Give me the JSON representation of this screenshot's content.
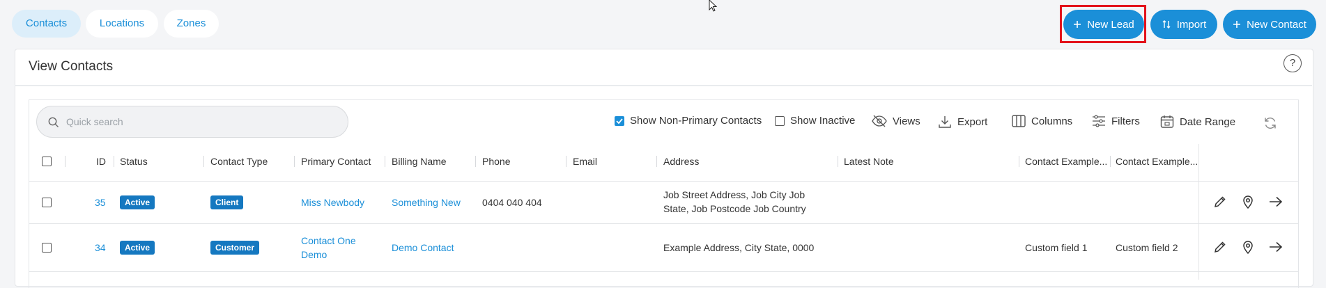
{
  "tabs": [
    {
      "label": "Contacts",
      "active": true
    },
    {
      "label": "Locations",
      "active": false
    },
    {
      "label": "Zones",
      "active": false
    }
  ],
  "actions": {
    "new_lead": "New Lead",
    "import": "Import",
    "new_contact": "New Contact"
  },
  "card": {
    "title": "View Contacts",
    "help": "?"
  },
  "toolbar": {
    "search_placeholder": "Quick search",
    "show_non_primary": "Show Non-Primary Contacts",
    "show_non_primary_checked": true,
    "show_inactive": "Show Inactive",
    "show_inactive_checked": false,
    "views": "Views",
    "export": "Export",
    "columns": "Columns",
    "filters": "Filters",
    "date_range": "Date Range"
  },
  "table": {
    "headers": [
      "ID",
      "Status",
      "Contact Type",
      "Primary Contact",
      "Billing Name",
      "Phone",
      "Email",
      "Address",
      "Latest Note",
      "Contact Example...",
      "Contact Example..."
    ],
    "rows": [
      {
        "id": "35",
        "status": "Active",
        "contact_type": "Client",
        "primary_contact": "Miss Newbody",
        "primary_contact_line2": "",
        "billing_name": "Something New",
        "phone": "0404 040 404",
        "email": "",
        "address_line1": "Job Street Address, Job City Job",
        "address_line2": "State, Job Postcode Job Country",
        "latest_note": "",
        "custom1": "",
        "custom2": ""
      },
      {
        "id": "34",
        "status": "Active",
        "contact_type": "Customer",
        "primary_contact": "Contact One",
        "primary_contact_line2": "Demo",
        "billing_name": "Demo Contact",
        "phone": "",
        "email": "",
        "address_line1": "Example Address, City State, 0000",
        "address_line2": "",
        "latest_note": "",
        "custom1": "Custom field 1",
        "custom2": "Custom field 2"
      }
    ]
  },
  "colors": {
    "accent": "#1b8fd8",
    "badge": "#1578c0",
    "highlight": "#e3131b"
  }
}
